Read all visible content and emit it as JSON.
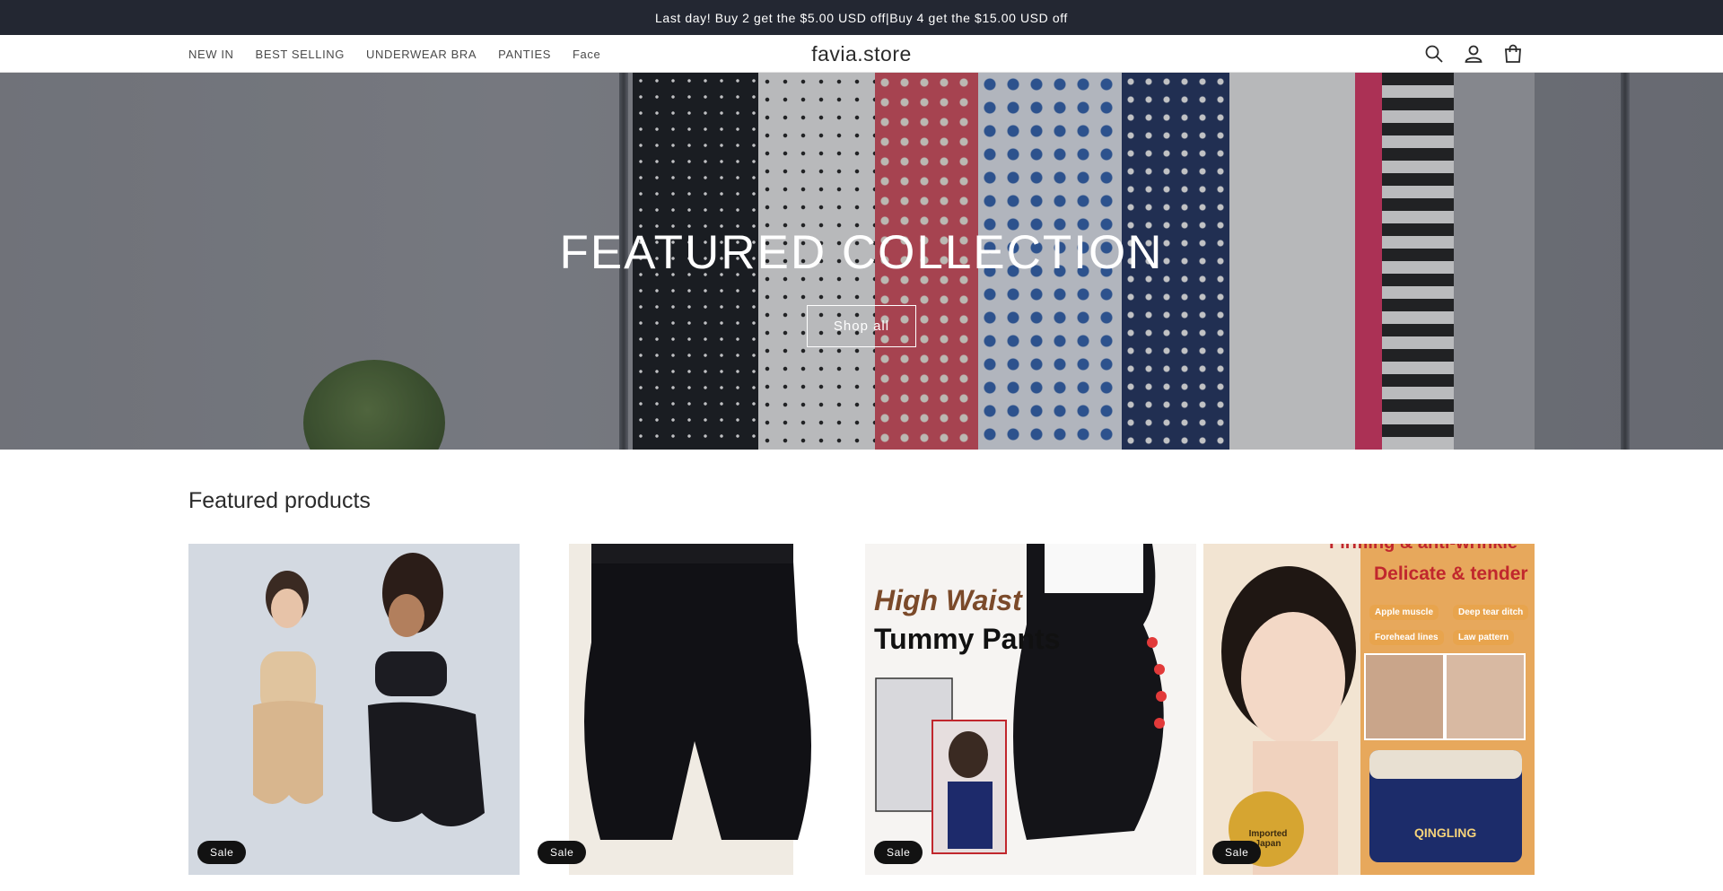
{
  "announcement": {
    "text": "Last day!   Buy 2 get the  $5.00 USD off|Buy 4 get the  $15.00 USD off"
  },
  "header": {
    "nav": [
      "NEW IN",
      "BEST SELLING",
      "UNDERWEAR BRA",
      "PANTIES",
      "Face"
    ],
    "logo": "favia.store",
    "icons": [
      "search-icon",
      "account-icon",
      "cart-icon"
    ]
  },
  "hero": {
    "title": "FEATURED COLLECTION",
    "button_label": "Shop all"
  },
  "featured": {
    "title": "Featured products",
    "products": [
      {
        "badge": "Sale"
      },
      {
        "badge": "Sale"
      },
      {
        "badge": "Sale",
        "image_text": [
          "High Waist",
          "Tummy Pants"
        ]
      },
      {
        "badge": "Sale",
        "image_text": [
          "Firming & anti-wrinkle",
          "Delicate & tender",
          "Apple muscle",
          "Deep tear ditch",
          "Forehead lines",
          "Law pattern",
          "QINGLING",
          "Imported Japan"
        ]
      }
    ]
  },
  "colors": {
    "announcement_bg": "#232732",
    "badge_bg": "#121212",
    "text": "#121212"
  }
}
